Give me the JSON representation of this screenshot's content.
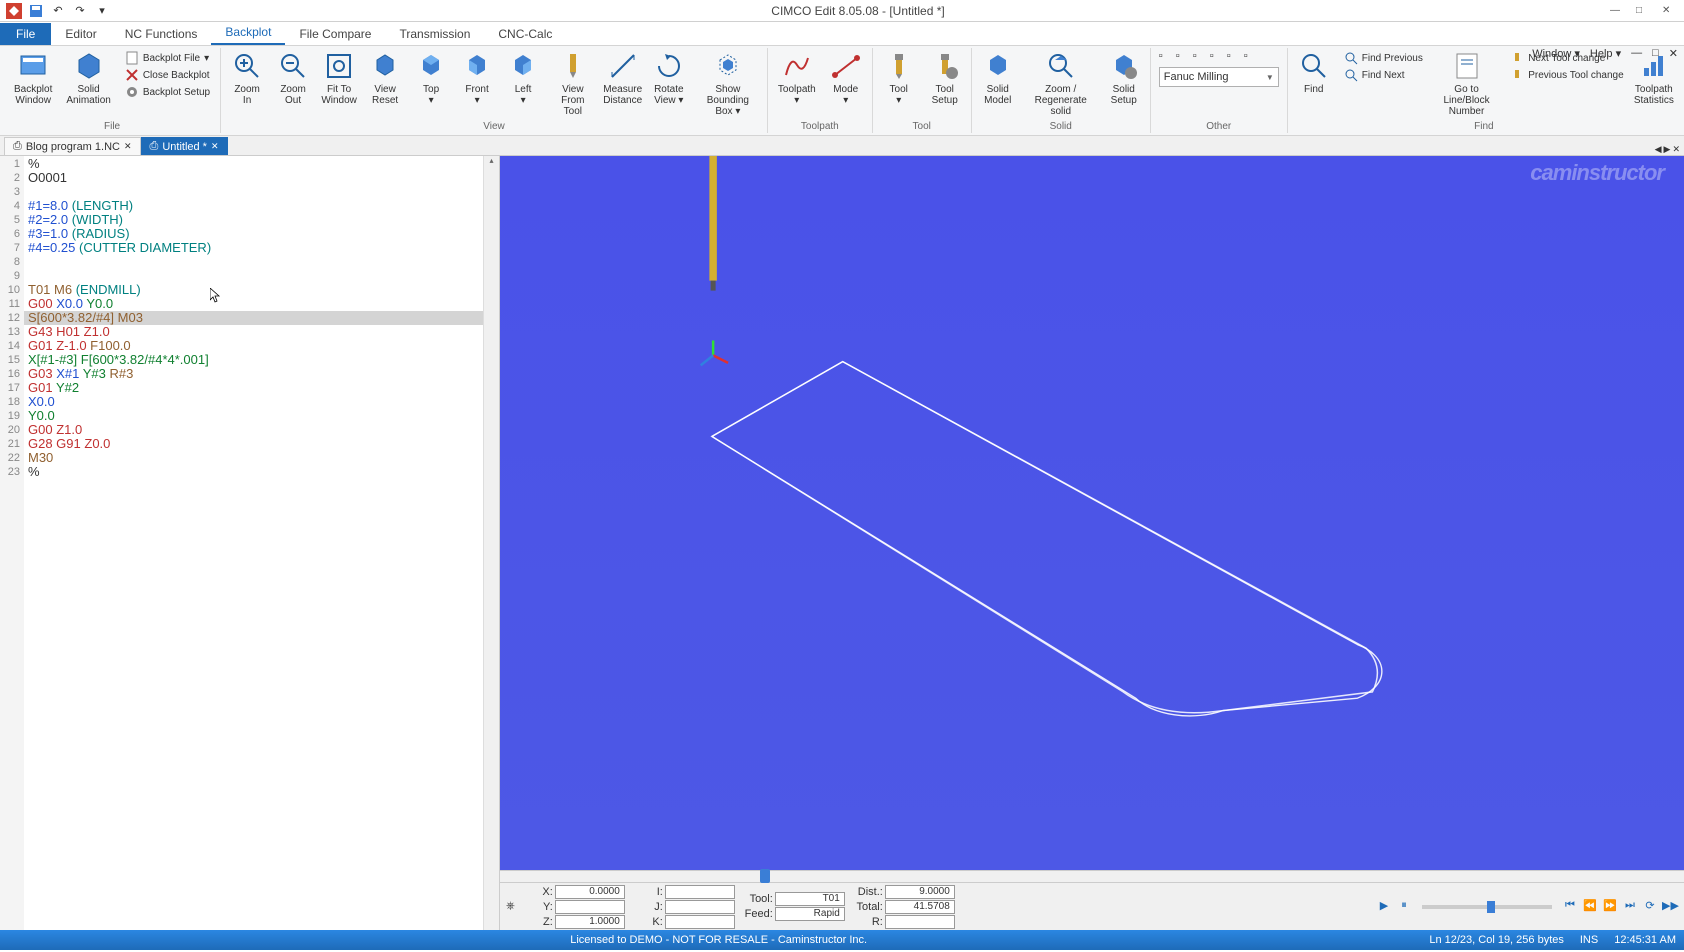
{
  "app": {
    "title": "CIMCO Edit 8.05.08 - [Untitled *]",
    "watermark": "caminstructor"
  },
  "menubar_extra": {
    "window": "Window",
    "help": "Help"
  },
  "tabs": {
    "file": "File",
    "editor": "Editor",
    "nc_functions": "NC Functions",
    "backplot": "Backplot",
    "file_compare": "File Compare",
    "transmission": "Transmission",
    "cnc_calc": "CNC-Calc"
  },
  "ribbon": {
    "file_group": {
      "backplot_window": "Backplot\nWindow",
      "solid_animation": "Solid\nAnimation",
      "backplot_file": "Backplot File",
      "close_backplot": "Close Backplot",
      "backplot_setup": "Backplot Setup",
      "label": "File"
    },
    "view_group": {
      "zoom_in": "Zoom\nIn",
      "zoom_out": "Zoom\nOut",
      "fit_to_window": "Fit To\nWindow",
      "view_reset": "View\nReset",
      "top": "Top",
      "front": "Front",
      "left": "Left",
      "view_from_tool": "View From\nTool",
      "measure_distance": "Measure\nDistance",
      "rotate_view": "Rotate\nView",
      "show_bounding_box": "Show\nBounding Box",
      "label": "View"
    },
    "toolpath_group": {
      "toolpath": "Toolpath",
      "mode": "Mode",
      "label": "Toolpath"
    },
    "tool_group": {
      "tool": "Tool",
      "tool_setup": "Tool\nSetup",
      "label": "Tool"
    },
    "solid_group": {
      "solid_model": "Solid\nModel",
      "zoom_regen": "Zoom /\nRegenerate solid",
      "solid_setup": "Solid\nSetup",
      "label": "Solid"
    },
    "other_group": {
      "machine": "Fanuc Milling",
      "label": "Other"
    },
    "find_group": {
      "find": "Find",
      "find_previous": "Find Previous",
      "find_next": "Find Next",
      "goto_line": "Go to Line/Block\nNumber",
      "next_tool": "Next Tool change",
      "prev_tool": "Previous Tool change",
      "toolpath_stats": "Toolpath\nStatistics",
      "label": "Find"
    }
  },
  "doc_tabs": {
    "tab1": "Blog program 1.NC",
    "tab2": "Untitled *"
  },
  "code": {
    "lines": [
      {
        "n": 1,
        "raw": "%"
      },
      {
        "n": 2,
        "raw": "O0001"
      },
      {
        "n": 3,
        "raw": ""
      },
      {
        "n": 4,
        "html": "<span class='c-blue'>#1=8.0</span> <span class='c-teal'>(LENGTH)</span>"
      },
      {
        "n": 5,
        "html": "<span class='c-blue'>#2=2.0</span> <span class='c-teal'>(WIDTH)</span>"
      },
      {
        "n": 6,
        "html": "<span class='c-blue'>#3=1.0</span> <span class='c-teal'>(RADIUS)</span>"
      },
      {
        "n": 7,
        "html": "<span class='c-blue'>#4=0.25</span> <span class='c-teal'>(CUTTER DIAMETER)</span>"
      },
      {
        "n": 8,
        "raw": ""
      },
      {
        "n": 9,
        "raw": ""
      },
      {
        "n": 10,
        "html": "<span class='c-brown'>T01 M6</span> <span class='c-teal'>(ENDMILL)</span>"
      },
      {
        "n": 11,
        "html": "<span class='c-red'>G00</span> <span class='c-blue'>X0.0</span> <span class='c-green'>Y0.0</span>"
      },
      {
        "n": 12,
        "sel": true,
        "html": "<span class='c-brown'>S[600*3.82/#4]</span> <span class='c-brown'>M03</span>"
      },
      {
        "n": 13,
        "html": "<span class='c-red'>G43 H01</span> <span class='c-red'>Z1.0</span>"
      },
      {
        "n": 14,
        "html": "<span class='c-red'>G01</span> <span class='c-red'>Z-1.0</span> <span class='c-brown'>F100.0</span>"
      },
      {
        "n": 15,
        "html": "<span class='c-green'>X[#1-#3]</span> <span class='c-green'>F[600*3.82/#4*4*.001]</span>"
      },
      {
        "n": 16,
        "html": "<span class='c-red'>G03</span> <span class='c-blue'>X#1</span> <span class='c-green'>Y#3</span> <span class='c-brown'>R#3</span>"
      },
      {
        "n": 17,
        "html": "<span class='c-red'>G01</span> <span class='c-green'>Y#2</span>"
      },
      {
        "n": 18,
        "html": "<span class='c-blue'>X0.0</span>"
      },
      {
        "n": 19,
        "html": "<span class='c-green'>Y0.0</span>"
      },
      {
        "n": 20,
        "html": "<span class='c-red'>G00</span> <span class='c-red'>Z1.0</span>"
      },
      {
        "n": 21,
        "html": "<span class='c-red'>G28 G91</span> <span class='c-red'>Z0.0</span>"
      },
      {
        "n": 22,
        "html": "<span class='c-brown'>M30</span>"
      },
      {
        "n": 23,
        "raw": "%"
      }
    ]
  },
  "coords": {
    "x_lbl": "X:",
    "x_val": "0.0000",
    "y_lbl": "Y:",
    "y_val": "",
    "z_lbl": "Z:",
    "z_val": "1.0000",
    "i_lbl": "I:",
    "i_val": "",
    "j_lbl": "J:",
    "j_val": "",
    "k_lbl": "K:",
    "k_val": "",
    "tool_lbl": "Tool:",
    "tool_val": "T01",
    "feed_lbl": "Feed:",
    "feed_val": "Rapid",
    "dist_lbl": "Dist.:",
    "dist_val": "9.0000",
    "total_lbl": "Total:",
    "total_val": "41.5708",
    "r_lbl": "R:",
    "r_val": ""
  },
  "statusbar": {
    "center": "Licensed to DEMO - NOT FOR RESALE - Caminstructor Inc.",
    "pos": "Ln 12/23, Col 19, 256 bytes",
    "ins": "INS",
    "time": "12:45:31 AM"
  }
}
